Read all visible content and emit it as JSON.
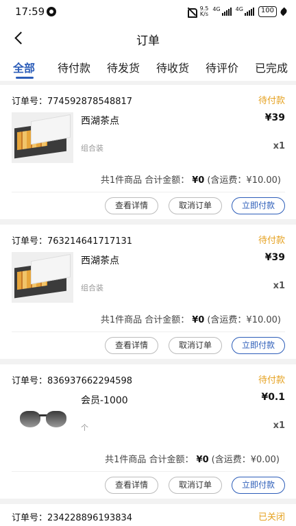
{
  "status_bar": {
    "time": "17:59",
    "speed_top": "9.5",
    "speed_bottom": "K/s",
    "net1": "4G",
    "net2": "4G",
    "battery": "100"
  },
  "header": {
    "title": "订单"
  },
  "tabs": [
    {
      "label": "全部",
      "active": true
    },
    {
      "label": "待付款"
    },
    {
      "label": "待发货"
    },
    {
      "label": "待收货"
    },
    {
      "label": "待评价"
    },
    {
      "label": "已完成"
    }
  ],
  "orders": [
    {
      "order_no": "订单号：774592878548817",
      "status": "待付款",
      "product_name": "西湖茶点",
      "price": "¥39",
      "spec": "组合装",
      "qty": "x1",
      "summary_prefix": "共1件商品 合计金额：",
      "amount": "¥0",
      "shipping": "(含运费：¥10.00)",
      "buttons": [
        "查看详情",
        "取消订单",
        "立即付款"
      ]
    },
    {
      "order_no": "订单号：763214641717131",
      "status": "待付款",
      "product_name": "西湖茶点",
      "price": "¥39",
      "spec": "组合装",
      "qty": "x1",
      "summary_prefix": "共1件商品 合计金额：",
      "amount": "¥0",
      "shipping": "(含运费：¥10.00)",
      "buttons": [
        "查看详情",
        "取消订单",
        "立即付款"
      ]
    },
    {
      "order_no": "订单号：836937662294598",
      "status": "待付款",
      "product_name": "会员-1000",
      "price": "¥0.1",
      "spec": "个",
      "qty": "x1",
      "summary_prefix": "共1件商品 合计金额：",
      "amount": "¥0",
      "shipping": "(含运费：¥0.00)",
      "buttons": [
        "查看详情",
        "取消订单",
        "立即付款"
      ]
    },
    {
      "order_no": "订单号：234228896193834",
      "status": "已关闭"
    }
  ],
  "colors": {
    "accent": "#2b5cb8",
    "pending": "#e5a11f",
    "background": "#f2f2f2"
  },
  "icons": [
    "alarm-icon",
    "mute-icon",
    "signal-icon",
    "battery-icon",
    "back-icon"
  ]
}
